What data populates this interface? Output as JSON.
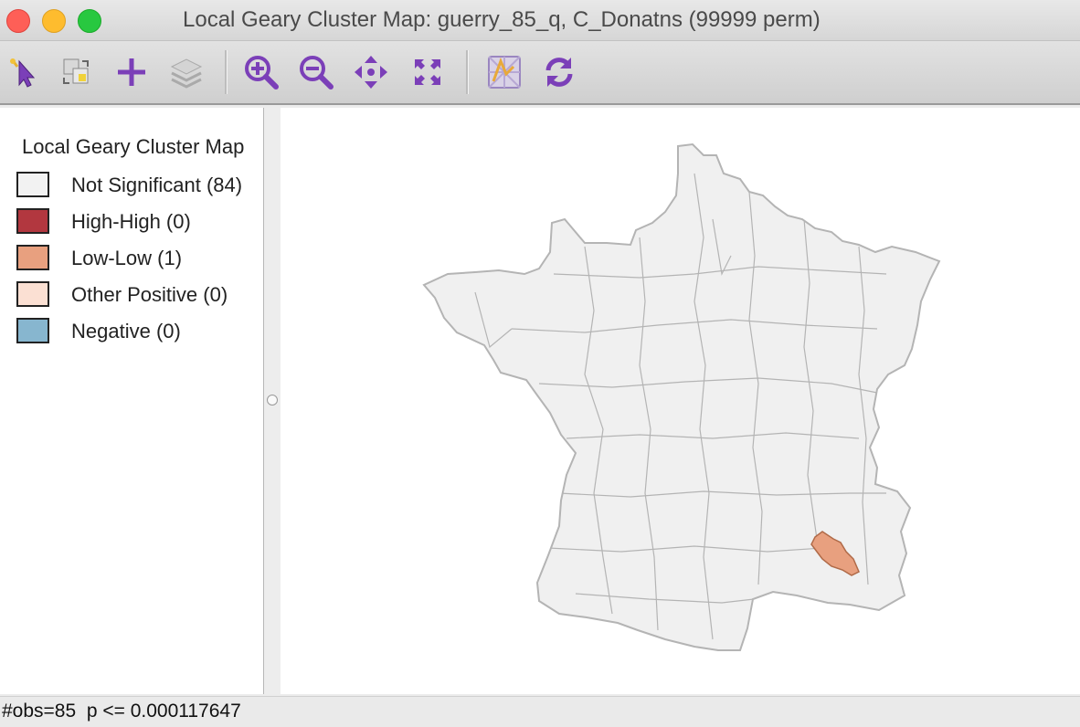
{
  "window": {
    "title": "Local Geary Cluster Map: guerry_85_q, C_Donatns (99999 perm)"
  },
  "toolbar": {
    "tools": [
      {
        "name": "select-pointer-icon"
      },
      {
        "name": "layer-switch-icon"
      },
      {
        "name": "add-layer-icon"
      },
      {
        "name": "layers-stack-icon"
      },
      {
        "name": "zoom-in-icon"
      },
      {
        "name": "zoom-out-icon"
      },
      {
        "name": "pan-icon"
      },
      {
        "name": "full-extent-icon"
      },
      {
        "name": "basemap-icon"
      },
      {
        "name": "refresh-icon"
      }
    ]
  },
  "legend": {
    "title": "Local Geary Cluster Map",
    "items": [
      {
        "label": "Not Significant (84)",
        "color": "#f2f2f2"
      },
      {
        "label": "High-High (0)",
        "color": "#b2373f"
      },
      {
        "label": "Low-Low (1)",
        "color": "#e8a07f"
      },
      {
        "label": "Other Positive (0)",
        "color": "#fbe0d3"
      },
      {
        "label": "Negative (0)",
        "color": "#87b6cf"
      }
    ]
  },
  "map": {
    "region_fill": "#f0f0f0",
    "region_stroke": "#b4b4b4",
    "highlight_fill": "#e8a07f",
    "highlight_stroke": "#b06a48"
  },
  "status": {
    "text": "#obs=85  p <= 0.000117647"
  }
}
